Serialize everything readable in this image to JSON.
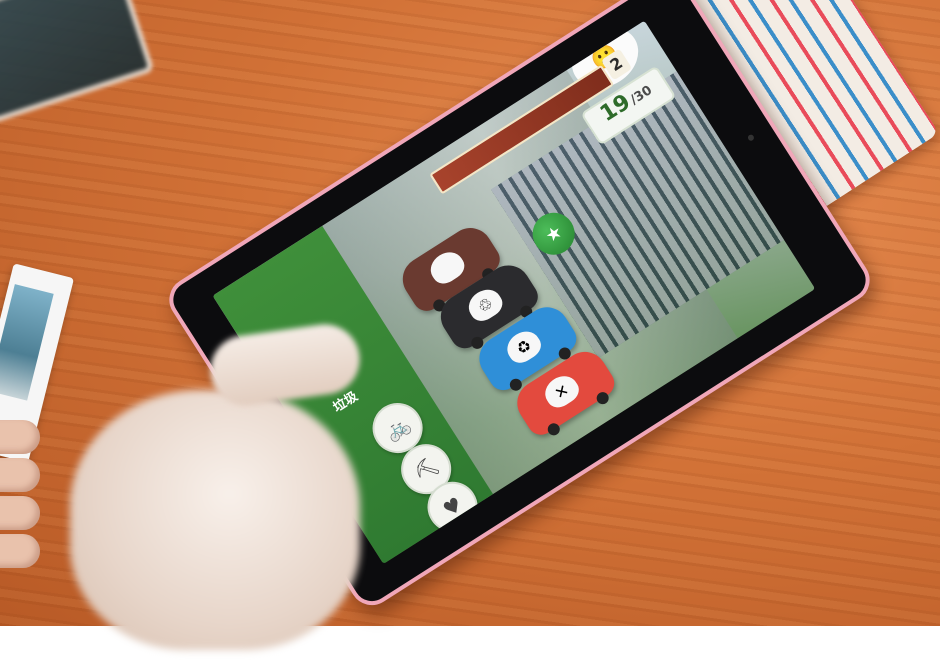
{
  "scene": {
    "description_colors": {
      "table": "#d27237",
      "tablet_frame": "#f0a7b9",
      "screen_sidebar": "#3f8f3a"
    }
  },
  "game": {
    "sidebar_label": "垃圾",
    "level": "2",
    "score": {
      "current": "19",
      "total": "/30"
    },
    "choices": [
      {
        "icon": "bicycle-icon",
        "glyph": "🚲"
      },
      {
        "icon": "tools-icon",
        "glyph": "⛏"
      },
      {
        "icon": "heart-icon",
        "glyph": "♥"
      }
    ],
    "bins": [
      {
        "name": "bin-dark-brown",
        "color": "#6a3a30",
        "symbol": ""
      },
      {
        "name": "bin-black",
        "color": "#2b2b2e",
        "symbol": "♲"
      },
      {
        "name": "bin-blue",
        "color": "#2f8fd8",
        "symbol": "♻"
      },
      {
        "name": "bin-red",
        "color": "#e34a3e",
        "symbol": "✕"
      }
    ],
    "avatar": "🙂"
  }
}
